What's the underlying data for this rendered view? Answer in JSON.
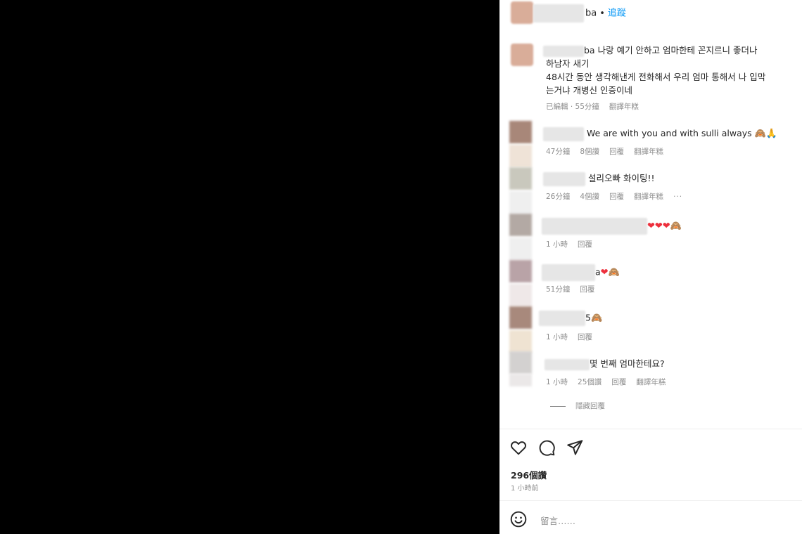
{
  "post": {
    "username_suffix": "ba",
    "dot": "•",
    "follow_label": "追蹤"
  },
  "comments": [
    {
      "user_suffix": "ba",
      "lines": [
        "나랑 예기 안하고 엄마한테 꼰지르니 좋더나",
        "하남자 새기",
        "48시간 동안 생각해낸게 전화해서 우리 엄마 통해서 나 입막",
        "는거냐 개병신 인증이네"
      ],
      "time": "已編輯 · 55分鐘",
      "translate": "翻譯年糕"
    },
    {
      "text": "We are with you and with sulli always",
      "emoji": "🙈🙏",
      "time": "47分鐘",
      "likes": "8個讚",
      "reply": "回覆",
      "translate": "翻譯年糕"
    },
    {
      "text": "설리오빠 화이팅!!",
      "time": "26分鐘",
      "likes": "4個讚",
      "reply": "回覆",
      "translate": "翻譯年糕",
      "more": "···"
    },
    {
      "hearts": "❤❤❤",
      "emoji": "🙈",
      "time": "1 小時",
      "reply": "回覆"
    },
    {
      "text_suffix": "a",
      "hearts": "❤",
      "emoji": "🙈",
      "time": "51分鐘",
      "reply": "回覆"
    },
    {
      "text_suffix": "5",
      "emoji": "🙈",
      "time": "1 小時",
      "reply": "回覆"
    },
    {
      "text": "몇 번째 엄마한테요?",
      "time": "1 小時",
      "likes": "25個讚",
      "reply": "回覆",
      "translate": "翻譯年糕"
    }
  ],
  "hide_replies": "隱藏回覆",
  "likes_count": "296個讚",
  "posted_time": "1 小時前",
  "comment_input": {
    "placeholder": "留言……"
  },
  "icons": {
    "like": "heart-outline-icon",
    "comment": "speech-bubble-icon",
    "share": "paper-plane-icon",
    "emoji": "smiley-icon"
  },
  "colors": {
    "follow": "#0095f6",
    "heart": "#ed2f3c",
    "meta": "#8e8e8e"
  }
}
